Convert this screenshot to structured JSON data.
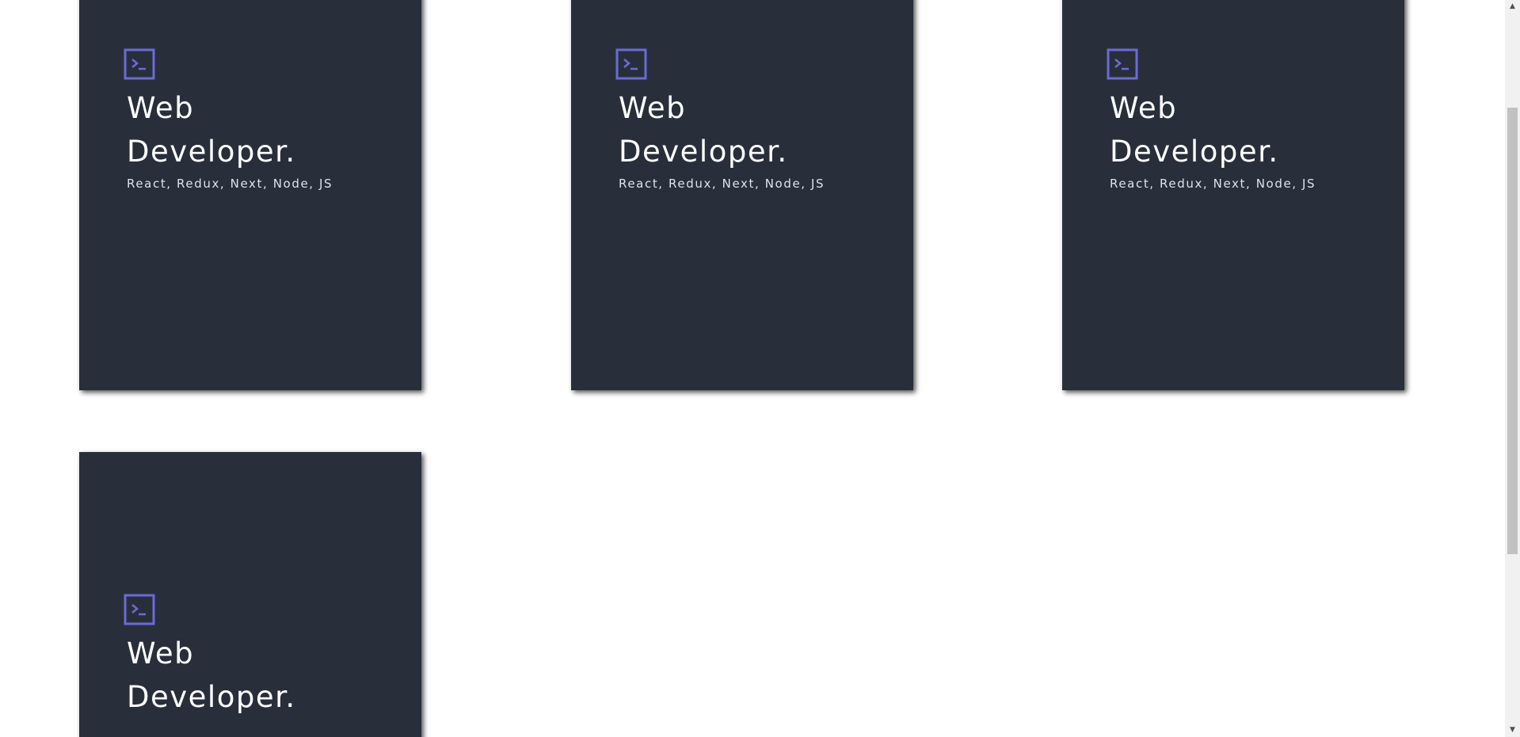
{
  "cards": [
    {
      "icon": "terminal-icon",
      "title_line1": "Web",
      "title_line2": "Developer.",
      "tags": "React, Redux, Next, Node, JS"
    },
    {
      "icon": "terminal-icon",
      "title_line1": "Web",
      "title_line2": "Developer.",
      "tags": "React, Redux, Next, Node, JS"
    },
    {
      "icon": "terminal-icon",
      "title_line1": "Web",
      "title_line2": "Developer.",
      "tags": "React, Redux, Next, Node, JS"
    },
    {
      "icon": "terminal-icon",
      "title_line1": "Web",
      "title_line2": "Developer."
    }
  ],
  "colors": {
    "card_background": "#282f3b",
    "icon_accent": "#6b6bd6",
    "title_text": "#ffffff",
    "tags_text": "#dfe2e8",
    "page_background": "#ffffff"
  },
  "scrollbar": {
    "up_arrow": "▲",
    "down_arrow": "▼"
  }
}
